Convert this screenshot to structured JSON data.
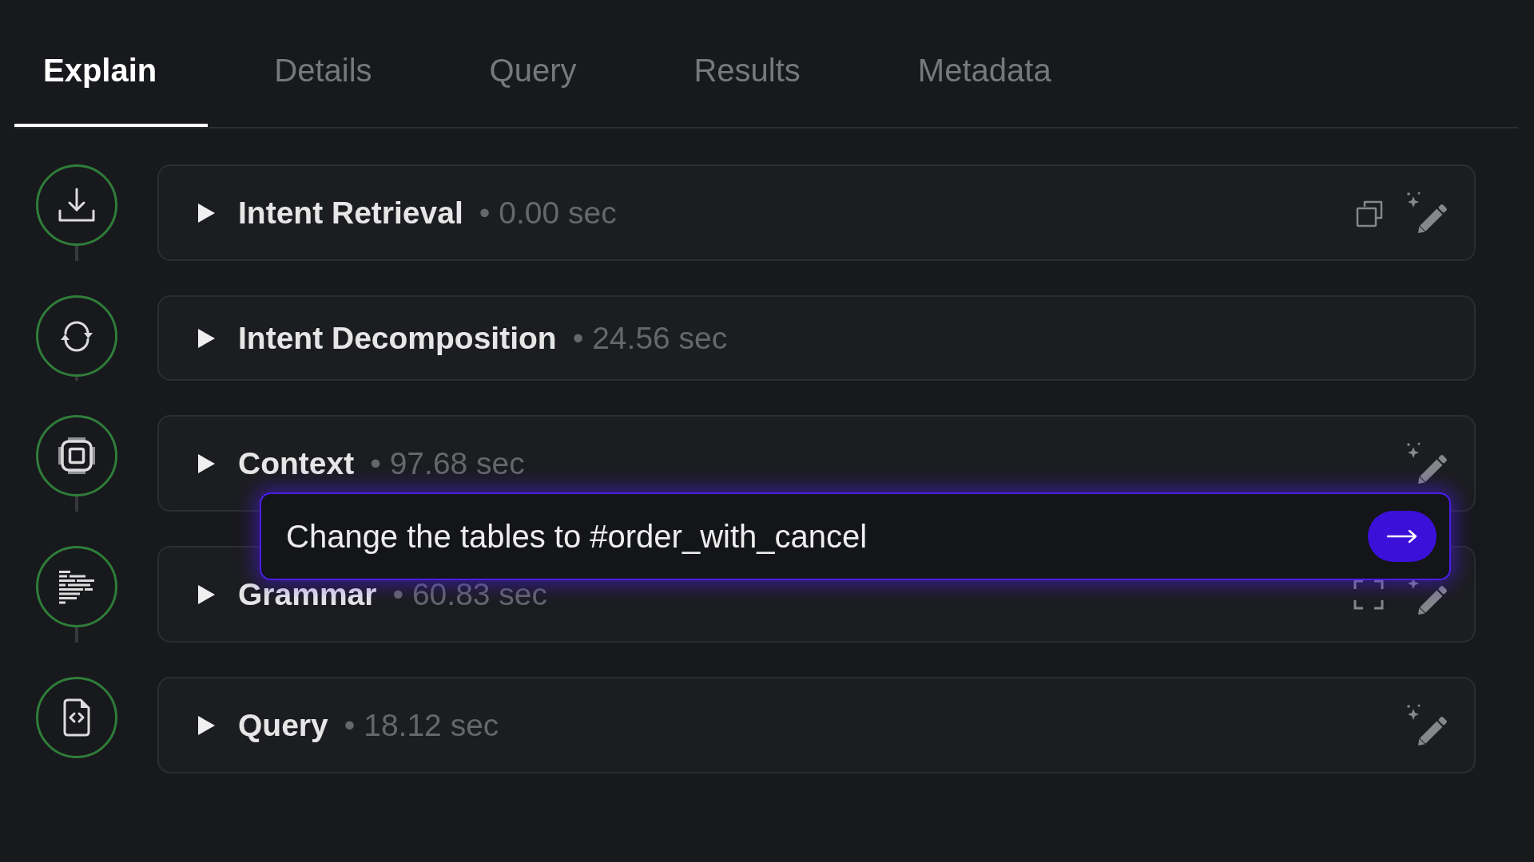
{
  "tabs": [
    {
      "label": "Explain",
      "selected": true
    },
    {
      "label": "Details",
      "selected": false
    },
    {
      "label": "Query",
      "selected": false
    },
    {
      "label": "Results",
      "selected": false
    },
    {
      "label": "Metadata",
      "selected": false
    }
  ],
  "steps": [
    {
      "title": "Intent Retrieval",
      "duration": "• 0.00 sec",
      "expanded": false,
      "actions": [
        {
          "kind": "copy"
        },
        {
          "kind": "magic_edit"
        }
      ]
    },
    {
      "title": "Intent Decomposition",
      "duration": "• 24.56 sec",
      "expanded": false
    },
    {
      "title": "Context",
      "duration": "• 97.68 sec",
      "expanded": false,
      "actions": [
        {
          "kind": "magic_edit"
        }
      ]
    },
    {
      "title": "Grammar",
      "duration": "• 60.83 sec",
      "expanded": false,
      "actions": [
        {
          "kind": "expand"
        },
        {
          "kind": "magic_edit"
        }
      ]
    },
    {
      "title": "Query",
      "duration": "• 18.12 sec",
      "expanded": false,
      "actions": [
        {
          "kind": "magic_edit"
        }
      ]
    }
  ],
  "prompt": {
    "value": "Change the tables to #order_with_cancel"
  }
}
